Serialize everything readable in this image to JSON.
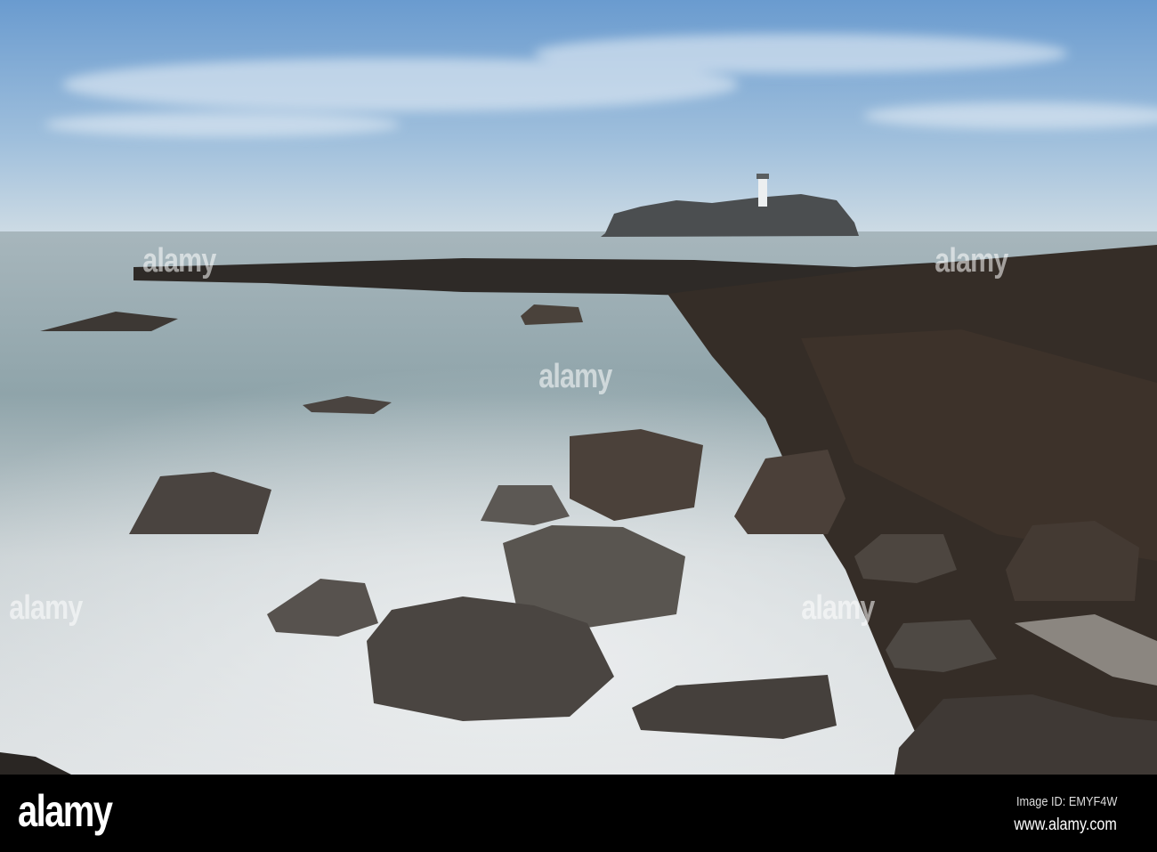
{
  "photo": {
    "subject": "lighthouse-island-seascape"
  },
  "watermark": {
    "text": "alamy"
  },
  "footer": {
    "logo": "alamy",
    "image_id": "Image ID: EMYF4W",
    "url": "www.alamy.com"
  },
  "colors": {
    "sky_top": "#6f9fd0",
    "horizon": "#c9d8e3",
    "sea": "#9fb0b6",
    "mist": "#e4e8ea",
    "rock": "#3a332d"
  }
}
